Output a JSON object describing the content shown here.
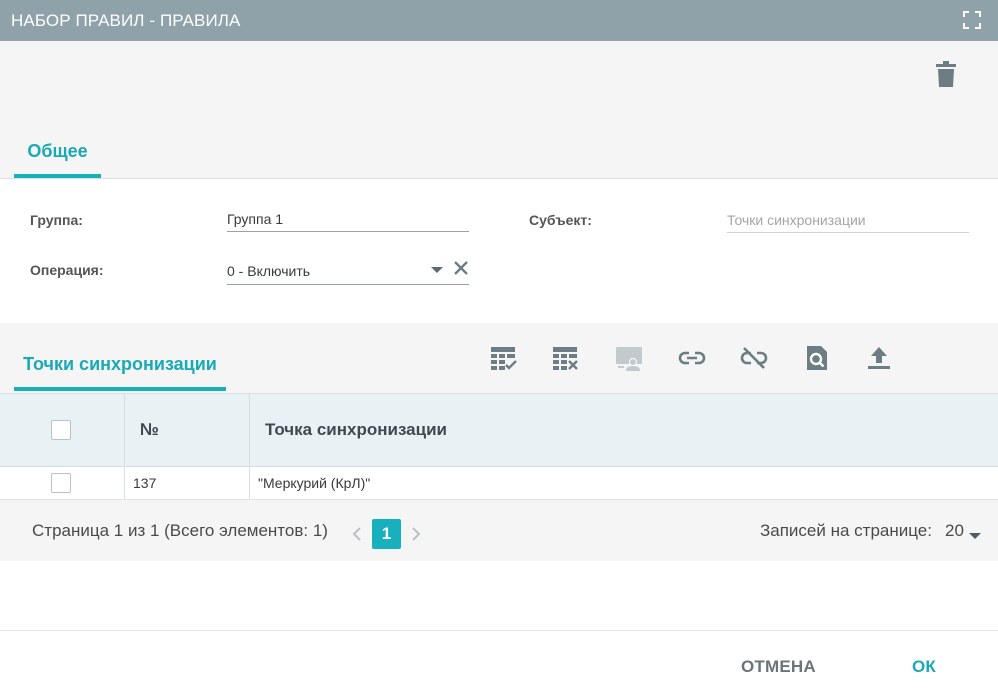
{
  "window": {
    "title": "НАБОР ПРАВИЛ - ПРАВИЛА"
  },
  "tabs": {
    "general": "Общее",
    "sync_points": "Точки синхронизации"
  },
  "form": {
    "group_label": "Группа:",
    "group_value": "Группа 1",
    "subject_label": "Субъект:",
    "subject_placeholder": "Точки синхронизации",
    "operation_label": "Операция:",
    "operation_value": "0 - Включить"
  },
  "toolbar_icons": [
    "select-all-icon",
    "deselect-all-icon",
    "assign-user-icon",
    "link-icon",
    "unlink-icon",
    "preview-icon",
    "upload-icon"
  ],
  "grid": {
    "columns": {
      "number": "№",
      "name": "Точка синхронизации"
    },
    "rows": [
      {
        "number": "137",
        "name": "\"Меркурий (КрЛ)\""
      }
    ]
  },
  "pager": {
    "info": "Страница 1 из 1 (Всего элементов: 1)",
    "current_page": "1",
    "per_page_label": "Записей на странице:",
    "per_page_value": "20"
  },
  "buttons": {
    "cancel": "ОТМЕНА",
    "ok": "ОК"
  },
  "colors": {
    "accent": "#19b0be",
    "titlebar": "#8fa2aa",
    "panel": "#f5f5f5",
    "grid_header": "#e8f2f5"
  }
}
